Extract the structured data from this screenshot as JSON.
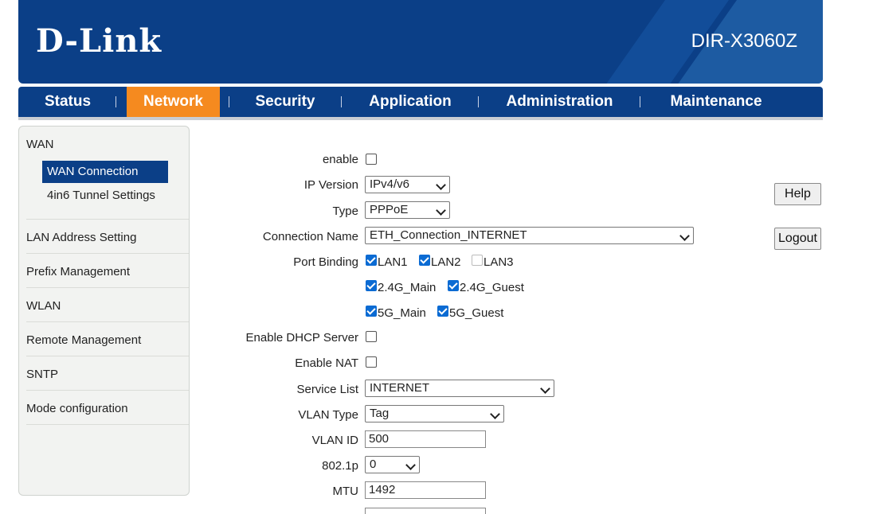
{
  "header": {
    "logo": "D-Link",
    "model": "DIR-X3060Z"
  },
  "nav": [
    {
      "label": "Status"
    },
    {
      "label": "Network"
    },
    {
      "label": "Security"
    },
    {
      "label": "Application"
    },
    {
      "label": "Administration"
    },
    {
      "label": "Maintenance"
    }
  ],
  "sidebar": {
    "wan": "WAN",
    "wan_connection": "WAN Connection",
    "tunnel": "4in6 Tunnel Settings",
    "lan": "LAN Address Setting",
    "prefix": "Prefix Management",
    "wlan": "WLAN",
    "remote": "Remote Management",
    "sntp": "SNTP",
    "mode": "Mode configuration"
  },
  "form": {
    "enable": {
      "label": "enable",
      "checked": false
    },
    "ip_version": {
      "label": "IP Version",
      "value": "IPv4/v6"
    },
    "type": {
      "label": "Type",
      "value": "PPPoE"
    },
    "connection_name": {
      "label": "Connection Name",
      "value": "ETH_Connection_INTERNET"
    },
    "port_binding": {
      "label": "Port Binding",
      "ports": [
        {
          "name": "LAN1",
          "checked": true
        },
        {
          "name": "LAN2",
          "checked": true
        },
        {
          "name": "LAN3",
          "checked": false
        },
        {
          "name": "2.4G_Main",
          "checked": true
        },
        {
          "name": "2.4G_Guest",
          "checked": true
        },
        {
          "name": "5G_Main",
          "checked": true
        },
        {
          "name": "5G_Guest",
          "checked": true
        }
      ]
    },
    "dhcp": {
      "label": "Enable DHCP Server",
      "checked": false
    },
    "nat": {
      "label": "Enable NAT",
      "checked": false
    },
    "service_list": {
      "label": "Service List",
      "value": "INTERNET"
    },
    "vlan_type": {
      "label": "VLAN Type",
      "value": "Tag"
    },
    "vlan_id": {
      "label": "VLAN ID",
      "value": "500"
    },
    "dot1p": {
      "label": "802.1p",
      "value": "0"
    },
    "mtu": {
      "label": "MTU",
      "value": "1492"
    }
  },
  "buttons": {
    "help": "Help",
    "logout": "Logout"
  }
}
